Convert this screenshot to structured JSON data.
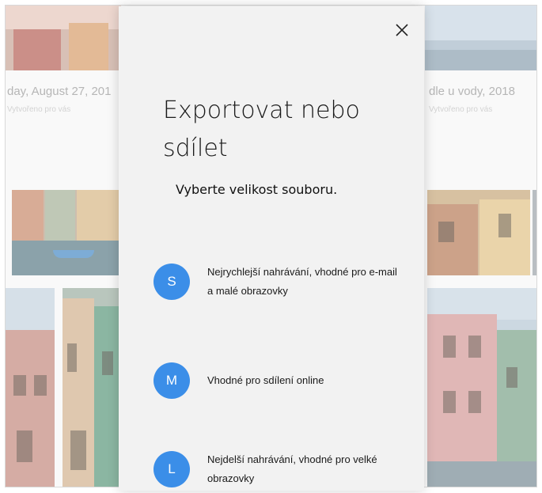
{
  "window": {
    "frame_color": "#f7f7f7"
  },
  "gallery": {
    "album_left": {
      "title": "day, August 27, 201",
      "subtitle": "Vytvořeno pro vás"
    },
    "album_right": {
      "title": "dle u vody, 2018",
      "subtitle": "Vytvořeno pro vás"
    }
  },
  "dialog": {
    "title": "Exportovat nebo sdílet",
    "subtitle": "Vyberte velikost souboru.",
    "close_icon": "close-icon",
    "accent": "#3b8ee8",
    "options": [
      {
        "letter": "S",
        "description": "Nejrychlejší nahrávání, vhodné pro e-mail a malé obrazovky"
      },
      {
        "letter": "M",
        "description": "Vhodné pro sdílení online"
      },
      {
        "letter": "L",
        "description": "Nejdelší nahrávání, vhodné pro velké obrazovky"
      }
    ]
  }
}
